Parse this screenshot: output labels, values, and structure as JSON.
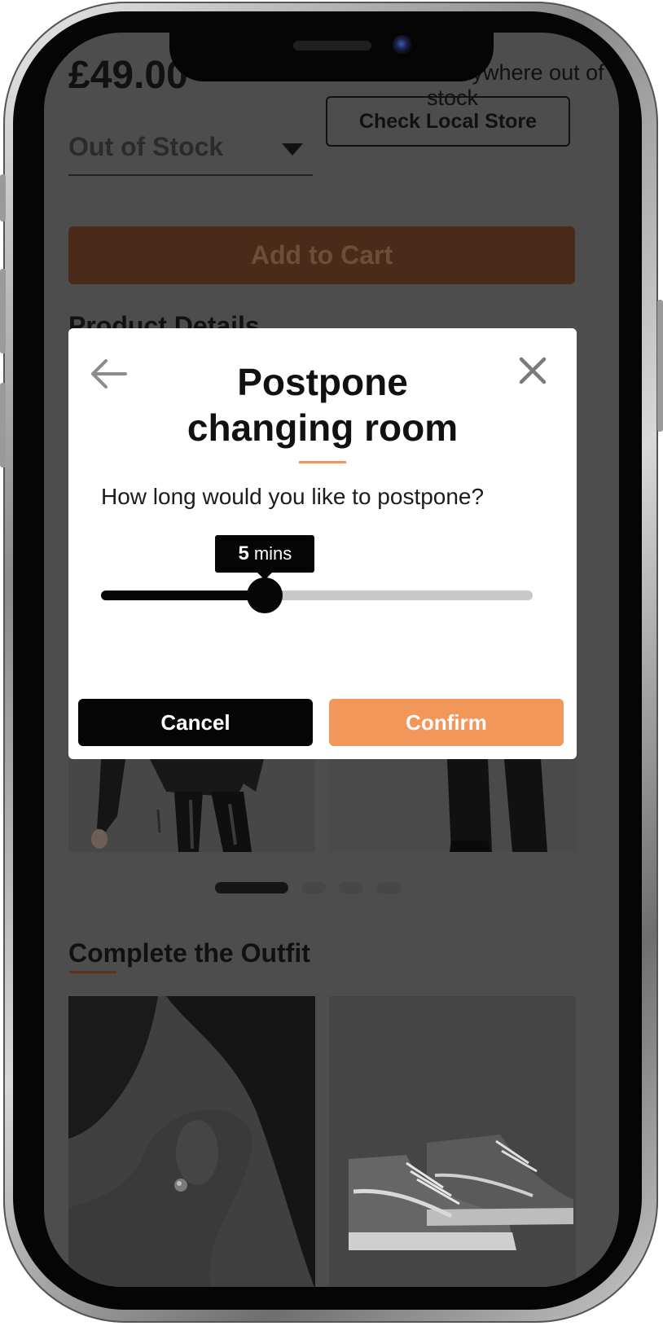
{
  "product": {
    "price": "£49.00",
    "availability_note": "Everywhere out of stock",
    "check_store_label": "Check Local Store",
    "size_select_value": "Out of Stock",
    "add_to_cart_label": "Add to Cart",
    "details_heading": "Product Details",
    "carousel": {
      "slide_count": 4,
      "active_slide": 1
    }
  },
  "outfit": {
    "heading": "Complete the Outfit"
  },
  "modal": {
    "title": "Postpone changing room",
    "question": "How long would you like to postpone?",
    "slider": {
      "value": "5",
      "unit": "mins",
      "fill_fraction": 0.38
    },
    "cancel_label": "Cancel",
    "confirm_label": "Confirm",
    "icons": {
      "back": "arrow-left-icon",
      "close": "close-icon"
    }
  },
  "colors": {
    "accent": "#f2965a",
    "primary": "#050505",
    "overlay": "#4d4d4d",
    "cart_button": "#4a2b19"
  }
}
